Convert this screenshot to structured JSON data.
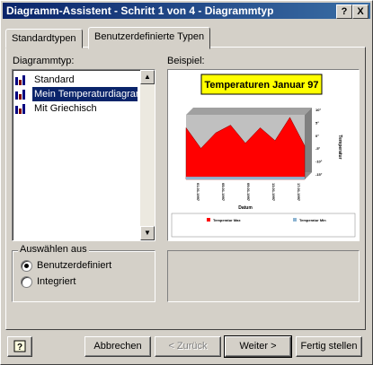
{
  "window": {
    "title": "Diagramm-Assistent - Schritt 1 von 4 - Diagrammtyp",
    "help_btn": "?",
    "close_btn": "X"
  },
  "tabs": [
    {
      "label": "Standardtypen",
      "active": false
    },
    {
      "label": "Benutzerdefinierte Typen",
      "active": true
    }
  ],
  "left": {
    "list_label": "Diagrammtyp:",
    "items": [
      {
        "label": "Standard",
        "icon": "bar-chart-icon",
        "selected": false
      },
      {
        "label": "Mein Temperaturdiagramm",
        "icon": "bar-chart-icon",
        "selected": true
      },
      {
        "label": "Mit Griechisch",
        "icon": "bar-chart-icon",
        "selected": false
      }
    ],
    "group_label": "Auswählen aus",
    "radios": [
      {
        "label": "Benutzerdefiniert",
        "checked": true
      },
      {
        "label": "Integriert",
        "checked": false
      }
    ]
  },
  "right": {
    "preview_label": "Beispiel:",
    "chart_title": "Temperaturen Januar 97",
    "y_axis_title": "Temperatur",
    "x_axis_title": "Datum",
    "y_ticks": [
      "10°",
      "5°",
      "0°",
      "-5°",
      "-10°",
      "-15°"
    ],
    "x_ticks": [
      "01.01.1997",
      "05.01.1997",
      "09.01.1997",
      "13.01.1997",
      "17.01.1997"
    ],
    "legend": [
      {
        "label": "Temperatur Max",
        "color": "#ff0000"
      },
      {
        "label": "Temperatur Min",
        "color": "#8cb4d2"
      }
    ]
  },
  "chart_data": {
    "type": "area",
    "title": "Temperaturen Januar 97",
    "xlabel": "Datum",
    "ylabel": "Temperatur",
    "x": [
      "01.01.1997",
      "03.01.1997",
      "05.01.1997",
      "07.01.1997",
      "09.01.1997",
      "11.01.1997",
      "13.01.1997",
      "15.01.1997",
      "17.01.1997"
    ],
    "series": [
      {
        "name": "Temperatur Max",
        "values": [
          5,
          -3,
          3,
          6,
          -1,
          5,
          0,
          9,
          -2
        ]
      },
      {
        "name": "Temperatur Min",
        "values": [
          -14,
          -14,
          -14,
          -14,
          -14,
          -14,
          -14,
          -14,
          -14
        ]
      }
    ],
    "ylim": [
      -15,
      10
    ]
  },
  "buttons": {
    "help_icon": "help-question-icon",
    "cancel": "Abbrechen",
    "back": "< Zurück",
    "next": "Weiter >",
    "finish": "Fertig stellen"
  }
}
